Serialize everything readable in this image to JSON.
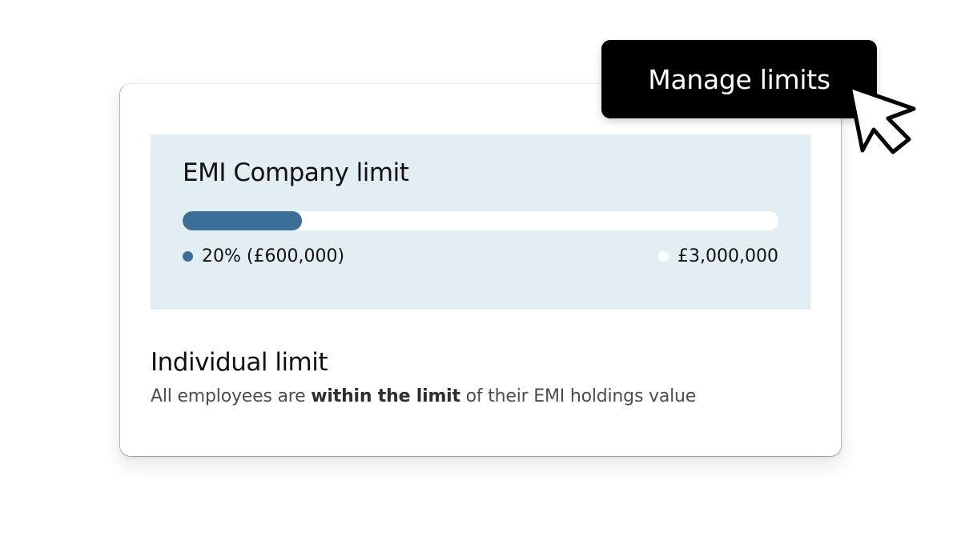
{
  "company_limit": {
    "title": "EMI Company limit",
    "progress_fraction": 0.2,
    "used_label": "20% (£600,000)",
    "total_label": "£3,000,000"
  },
  "individual_limit": {
    "title": "Individual limit",
    "desc_prefix": "All employees are ",
    "desc_bold": "within the limit",
    "desc_suffix": " of their EMI holdings value"
  },
  "manage_button": {
    "label": "Manage limits"
  },
  "colors": {
    "accent": "#3c6f97",
    "panel_bg": "#e3eef3",
    "button_bg": "#000000"
  },
  "icons": {
    "cursor": "mouse-pointer-icon"
  }
}
